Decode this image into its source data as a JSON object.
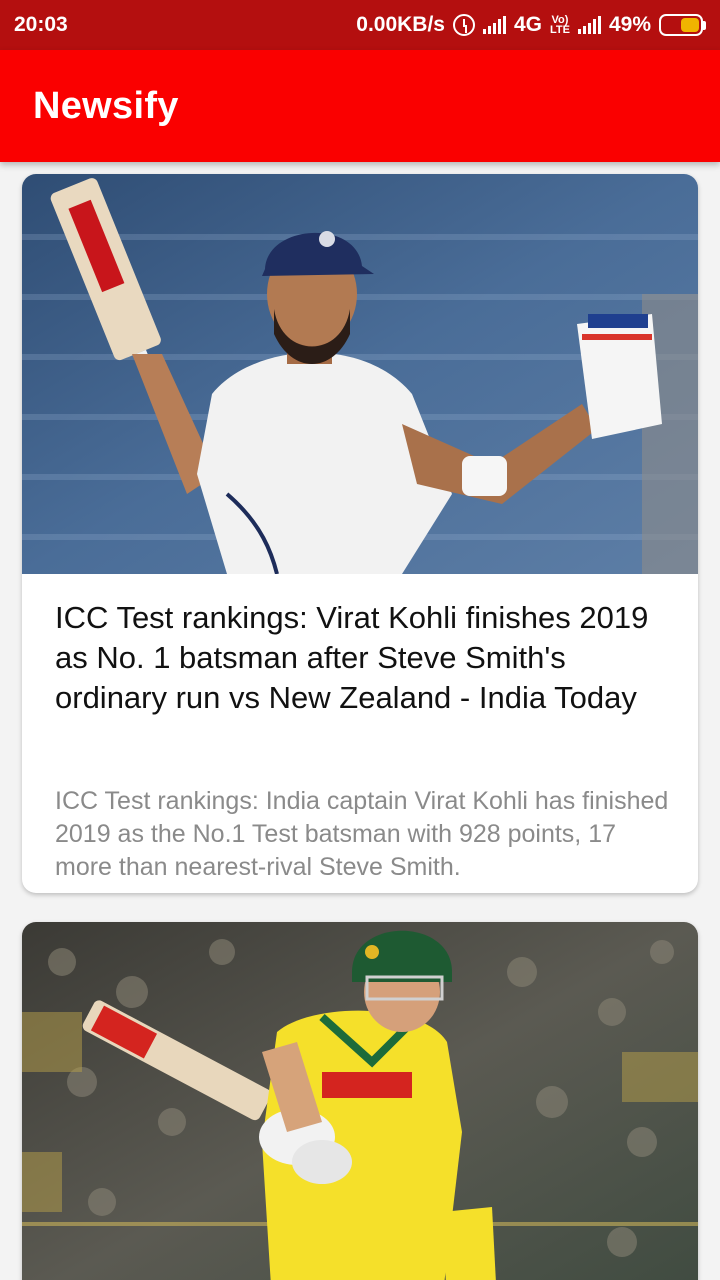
{
  "status_bar": {
    "time": "20:03",
    "data_rate": "0.00KB/s",
    "network": "4G",
    "volte_line1": "Vo)",
    "volte_line2": "LTE",
    "battery": "49%",
    "battery_level": 0.49
  },
  "app_bar": {
    "title": "Newsify",
    "color": "#fa0000"
  },
  "articles": [
    {
      "headline": "ICC Test rankings: Virat Kohli finishes 2019 as No. 1 batsman after Steve Smith's ordinary run vs New Zealand - India Today",
      "description": "ICC Test rankings: India captain Virat Kohli has finished 2019 as the No.1 Test batsman with 928 points, 17 more than nearest-rival Steve Smith.",
      "image": "cricketer-raising-bat-photo"
    },
    {
      "image": "cricketer-batting-yellow-kit-photo"
    }
  ]
}
